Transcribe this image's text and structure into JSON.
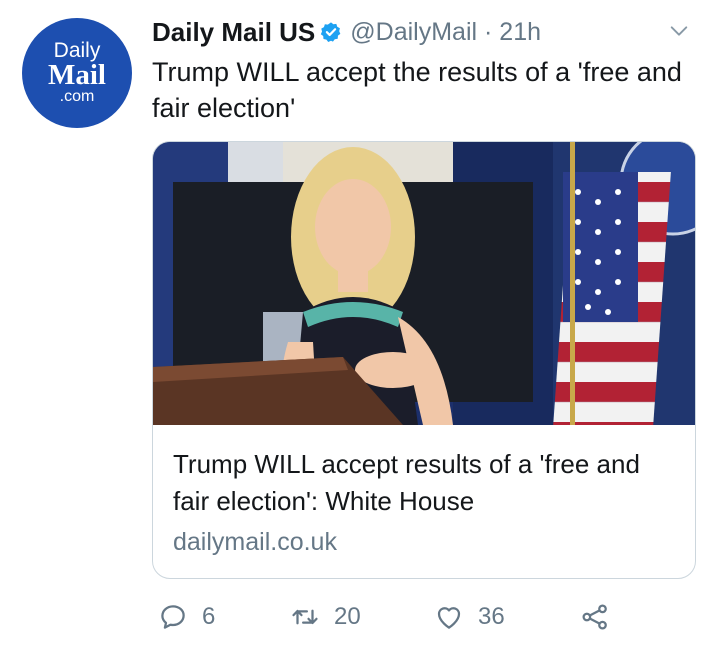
{
  "author": {
    "avatar_lines": [
      "Daily",
      "Mail",
      ".com"
    ],
    "display_name": "Daily Mail US",
    "handle": "@DailyMail",
    "separator": " · ",
    "time": "21h"
  },
  "tweet": {
    "text": "Trump WILL accept the results of a 'free and fair election'"
  },
  "card": {
    "title": "Trump WILL accept results of a 'free and fair election': White House",
    "domain": "dailymail.co.uk"
  },
  "actions": {
    "reply_count": "6",
    "retweet_count": "20",
    "like_count": "36"
  },
  "icons": {
    "verified": "verified-badge-icon",
    "menu": "chevron-down-icon",
    "reply": "reply-icon",
    "retweet": "retweet-icon",
    "like": "heart-icon",
    "share": "share-icon"
  },
  "colors": {
    "brand_blue": "#1d4fb0",
    "verified_blue": "#1da1f2",
    "secondary_text": "#657786",
    "border": "#ccd6dd"
  }
}
